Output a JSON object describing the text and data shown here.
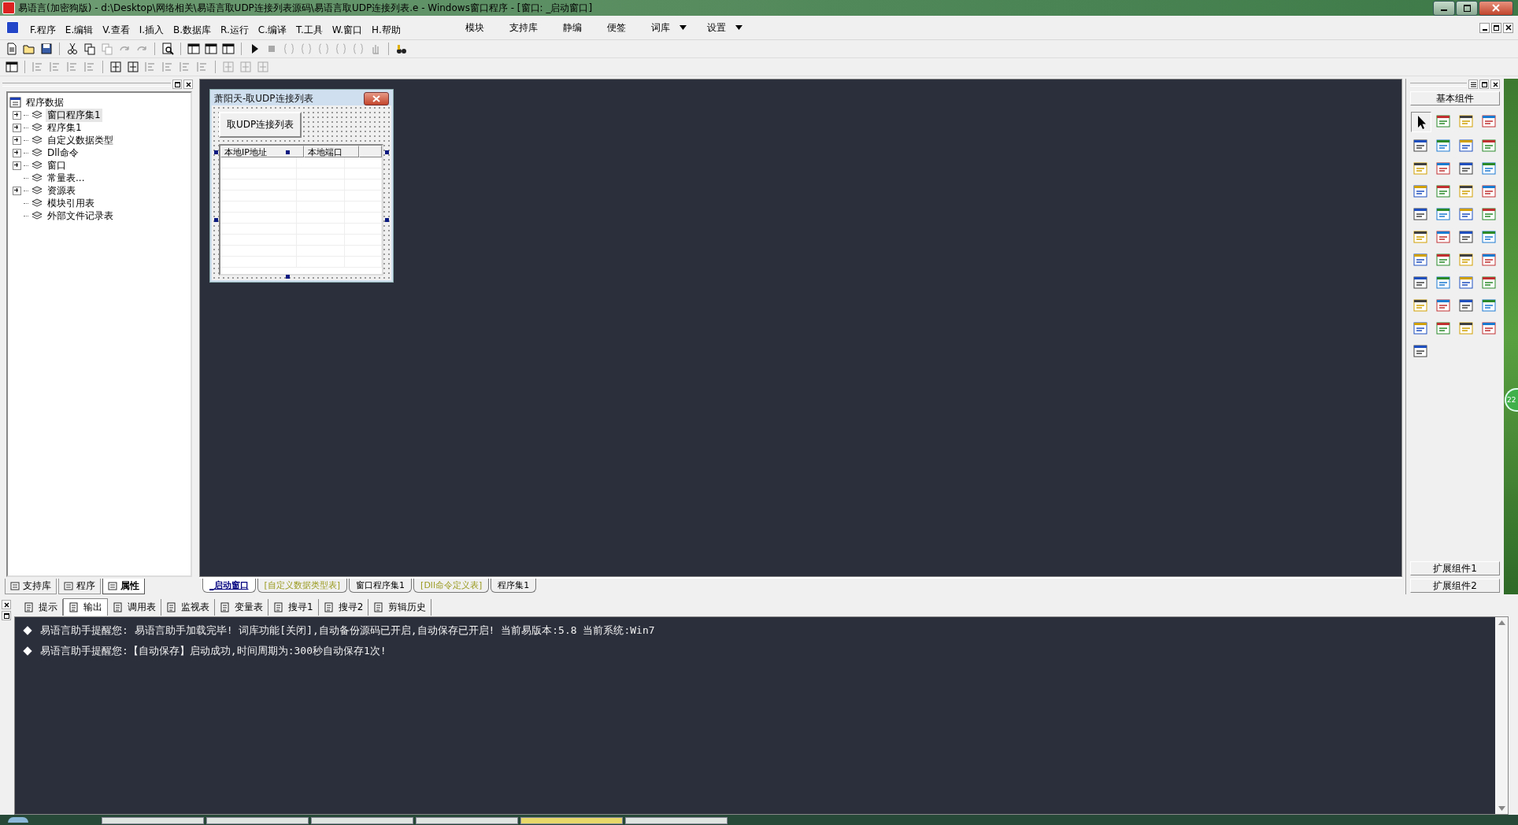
{
  "window": {
    "title": "易语言(加密狗版) - d:\\Desktop\\网络相关\\易语言取UDP连接列表源码\\易语言取UDP连接列表.e - Windows窗口程序 - [窗口: _启动窗口]"
  },
  "menu": [
    {
      "label": "F.程序"
    },
    {
      "label": "E.编辑"
    },
    {
      "label": "V.查看"
    },
    {
      "label": "I.插入"
    },
    {
      "label": "B.数据库"
    },
    {
      "label": "R.运行"
    },
    {
      "label": "C.编译"
    },
    {
      "label": "T.工具"
    },
    {
      "label": "W.窗口"
    },
    {
      "label": "H.帮助"
    }
  ],
  "menu_right": [
    {
      "label": "模块",
      "dropdown": false
    },
    {
      "label": "支持库",
      "dropdown": false
    },
    {
      "label": "静编",
      "dropdown": false
    },
    {
      "label": "便签",
      "dropdown": false
    },
    {
      "label": "词库",
      "dropdown": true
    },
    {
      "label": "设置",
      "dropdown": true
    }
  ],
  "tree": {
    "label": "程序数据",
    "children": [
      {
        "label": "窗口程序集1",
        "expandable": true,
        "selected": true
      },
      {
        "label": "程序集1",
        "expandable": true,
        "selected": false
      },
      {
        "label": "自定义数据类型",
        "expandable": true,
        "selected": false
      },
      {
        "label": "Dll命令",
        "expandable": true,
        "selected": false
      },
      {
        "label": "窗口",
        "expandable": true,
        "selected": false
      },
      {
        "label": "常量表...",
        "expandable": false,
        "selected": false
      },
      {
        "label": "资源表",
        "expandable": true,
        "selected": false
      },
      {
        "label": "模块引用表",
        "expandable": false,
        "selected": false
      },
      {
        "label": "外部文件记录表",
        "expandable": false,
        "selected": false
      }
    ]
  },
  "left_tabs": [
    {
      "label": "支持库",
      "selected": false
    },
    {
      "label": "程序",
      "selected": false
    },
    {
      "label": "属性",
      "selected": true
    }
  ],
  "form": {
    "title": "萧阳天-取UDP连接列表",
    "button": "取UDP连接列表",
    "columns": [
      "本地IP地址",
      "本地端口"
    ]
  },
  "doc_tabs": [
    {
      "label": "_启动窗口",
      "selected": true,
      "kind": "code"
    },
    {
      "label": "[自定义数据类型表]",
      "selected": false,
      "kind": "table"
    },
    {
      "label": "窗口程序集1",
      "selected": false,
      "kind": "code"
    },
    {
      "label": "[Dll命令定义表]",
      "selected": false,
      "kind": "table"
    },
    {
      "label": "程序集1",
      "selected": false,
      "kind": "code"
    }
  ],
  "toolbox": {
    "title": "基本组件",
    "groups": [
      "扩展组件1",
      "扩展组件2"
    ]
  },
  "bottom_tabs": [
    {
      "label": "提示",
      "selected": false
    },
    {
      "label": "输出",
      "selected": true
    },
    {
      "label": "调用表",
      "selected": false
    },
    {
      "label": "监视表",
      "selected": false
    },
    {
      "label": "变量表",
      "selected": false
    },
    {
      "label": "搜寻1",
      "selected": false
    },
    {
      "label": "搜寻2",
      "selected": false
    },
    {
      "label": "剪辑历史",
      "selected": false
    }
  ],
  "output": [
    "易语言助手提醒您:  易语言助手加载完毕!  词库功能[关闭],自动备份源码已开启,自动保存已开启!  当前易版本:5.8  当前系统:Win7",
    "易语言助手提醒您:【自动保存】启动成功,时间周期为:300秒自动保存1次!"
  ],
  "desktop_badge": "22"
}
